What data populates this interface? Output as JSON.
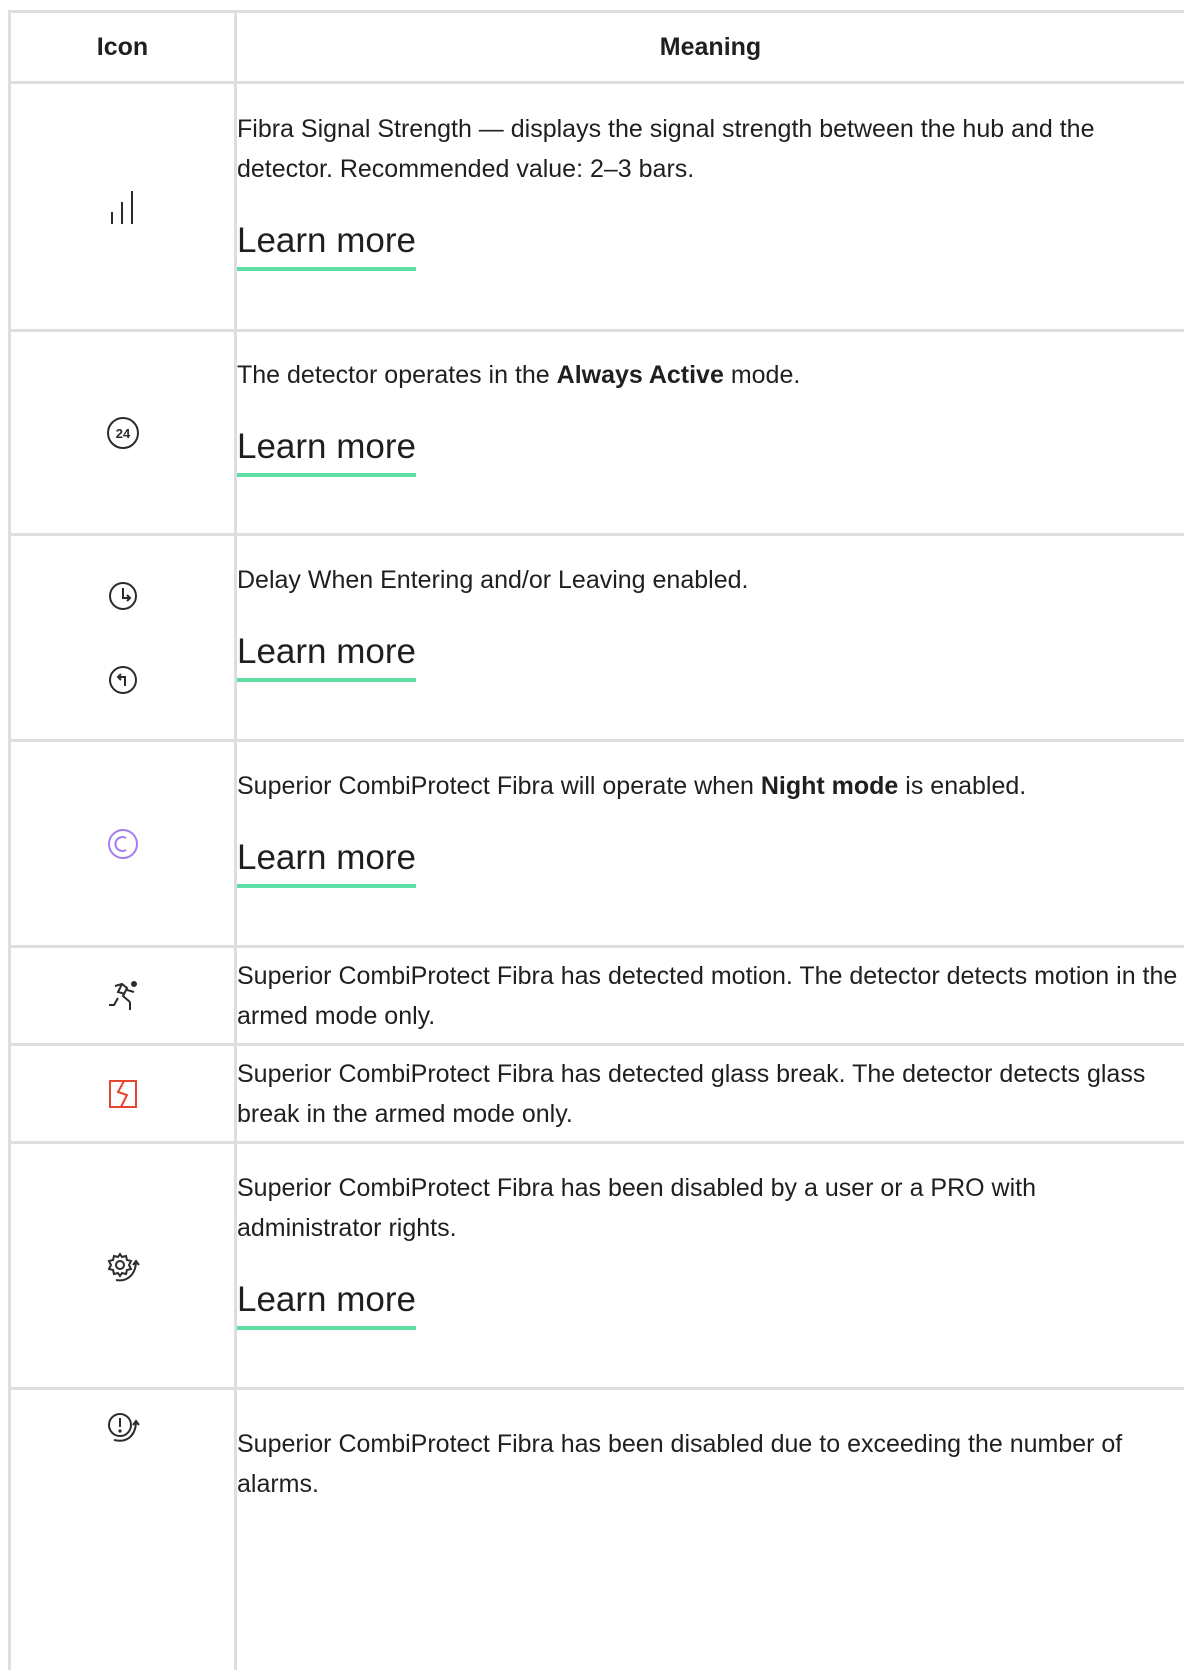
{
  "table": {
    "headers": {
      "icon": "Icon",
      "meaning": "Meaning"
    },
    "rows": [
      {
        "icons": [
          "signal-bars-icon"
        ],
        "text_parts": [
          "Fibra Signal Strength — displays the signal strength between the hub and the detector. Recommended value: 2–3 bars."
        ],
        "link": "Learn more"
      },
      {
        "icons": [
          "always-active-24-icon"
        ],
        "icon_text": "24",
        "text_parts": [
          "The detector operates in the ",
          "Always Active",
          " mode."
        ],
        "link": "Learn more"
      },
      {
        "icons": [
          "entry-delay-clock-icon",
          "exit-delay-clock-icon"
        ],
        "text_parts": [
          "Delay When Entering and/or Leaving enabled."
        ],
        "link": "Learn more"
      },
      {
        "icons": [
          "night-mode-icon"
        ],
        "text_parts": [
          "Superior CombiProtect Fibra will operate when ",
          "Night mode",
          " is enabled."
        ],
        "link": "Learn more"
      },
      {
        "icons": [
          "motion-detected-icon"
        ],
        "text_parts": [
          "Superior CombiProtect Fibra has detected motion. The detector detects motion in the armed mode only."
        ]
      },
      {
        "icons": [
          "glass-break-icon"
        ],
        "text_parts": [
          "Superior CombiProtect Fibra has detected glass break. The detector detects glass break in the armed mode only."
        ]
      },
      {
        "icons": [
          "disabled-by-user-gear-icon"
        ],
        "text_parts": [
          "Superior CombiProtect Fibra has been disabled by a user or a PRO with administrator rights."
        ],
        "link": "Learn more"
      },
      {
        "icons": [
          "disabled-alarms-exceeded-icon"
        ],
        "text_parts": [
          "Superior CombiProtect Fibra has been disabled due to exceeding the number of alarms."
        ]
      }
    ]
  },
  "colors": {
    "border": "#dedede",
    "link_underline": "#5fdfa5",
    "night_mode_icon": "#a77cf2",
    "glass_break_icon": "#e5462f",
    "text": "#1f1f1f"
  }
}
